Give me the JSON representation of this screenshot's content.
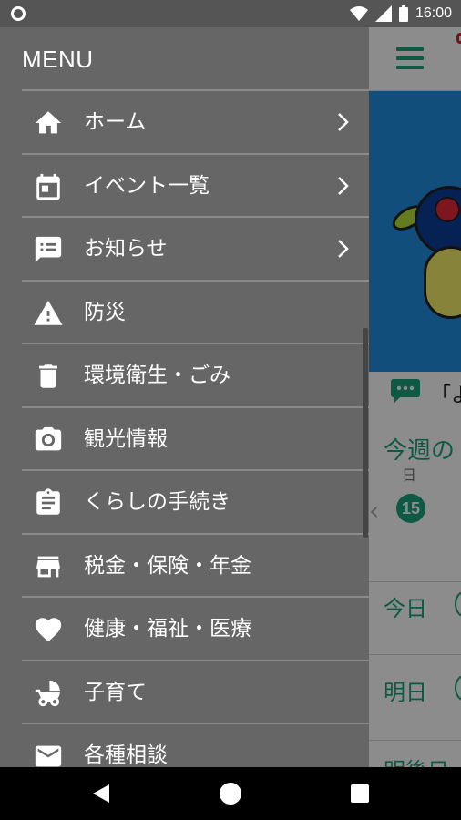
{
  "status_bar": {
    "time": "16:00",
    "icons": [
      "notification-dot-icon",
      "wifi-icon",
      "signal-icon",
      "battery-icon"
    ]
  },
  "drawer": {
    "title": "MENU",
    "items": [
      {
        "label": "ホーム",
        "icon": "home-icon",
        "has_chevron": true
      },
      {
        "label": "イベント一覧",
        "icon": "calendar-icon",
        "has_chevron": true
      },
      {
        "label": "お知らせ",
        "icon": "announcement-icon",
        "has_chevron": true
      },
      {
        "label": "防災",
        "icon": "warning-icon",
        "has_chevron": false
      },
      {
        "label": "環境衛生・ごみ",
        "icon": "trash-icon",
        "has_chevron": false
      },
      {
        "label": "観光情報",
        "icon": "camera-icon",
        "has_chevron": false
      },
      {
        "label": "くらしの手続き",
        "icon": "clipboard-icon",
        "has_chevron": false
      },
      {
        "label": "税金・保険・年金",
        "icon": "store-icon",
        "has_chevron": false
      },
      {
        "label": "健康・福祉・医療",
        "icon": "heart-icon",
        "has_chevron": false
      },
      {
        "label": "子育て",
        "icon": "stroller-icon",
        "has_chevron": false
      },
      {
        "label": "各種相談",
        "icon": "mail-icon",
        "has_chevron": false
      }
    ]
  },
  "background_app": {
    "ticker_text": "「よ",
    "week_title": "今週の",
    "day_header": "日",
    "date_badge": "15",
    "rows": [
      "今日",
      "明日",
      "明後日"
    ]
  },
  "colors": {
    "accent": "#1aa37a",
    "drawer_bg": "#666666",
    "banner_bg": "#1f8fe0",
    "status_bar": "#555555"
  }
}
